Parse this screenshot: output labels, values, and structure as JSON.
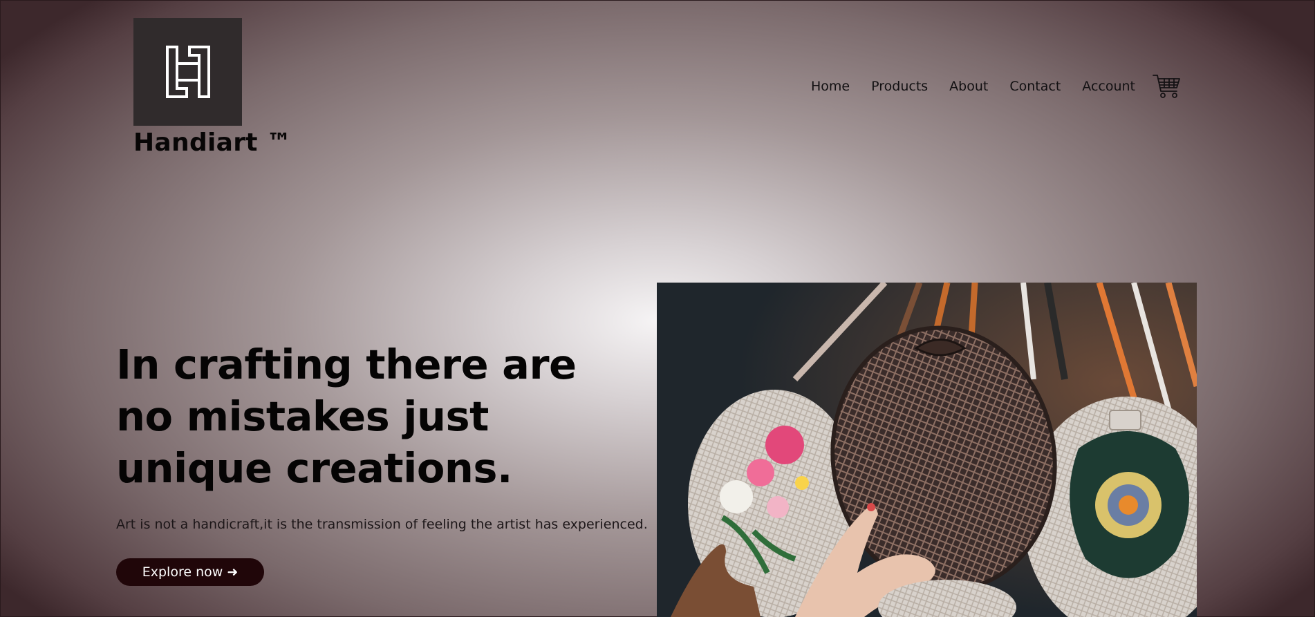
{
  "brand": {
    "logo_letter": "H",
    "name": "Handiart ™"
  },
  "nav": {
    "items": [
      {
        "label": "Home"
      },
      {
        "label": "Products"
      },
      {
        "label": "About"
      },
      {
        "label": "Contact"
      },
      {
        "label": "Account"
      }
    ],
    "cart_icon": "cart-icon"
  },
  "hero": {
    "title": "In crafting there are no mistakes just unique creations.",
    "subtitle": "Art is not a handicraft,it is the transmission of feeling the artist has experienced.",
    "cta_label": "Explore now ➜",
    "image_subject": "woven-rattan-bags"
  },
  "colors": {
    "logo_bg": "#302b2c",
    "button_bg": "#200609",
    "text_dark": "#050404",
    "background_center": "#f6f4f5",
    "background_edge": "#3d282c"
  }
}
